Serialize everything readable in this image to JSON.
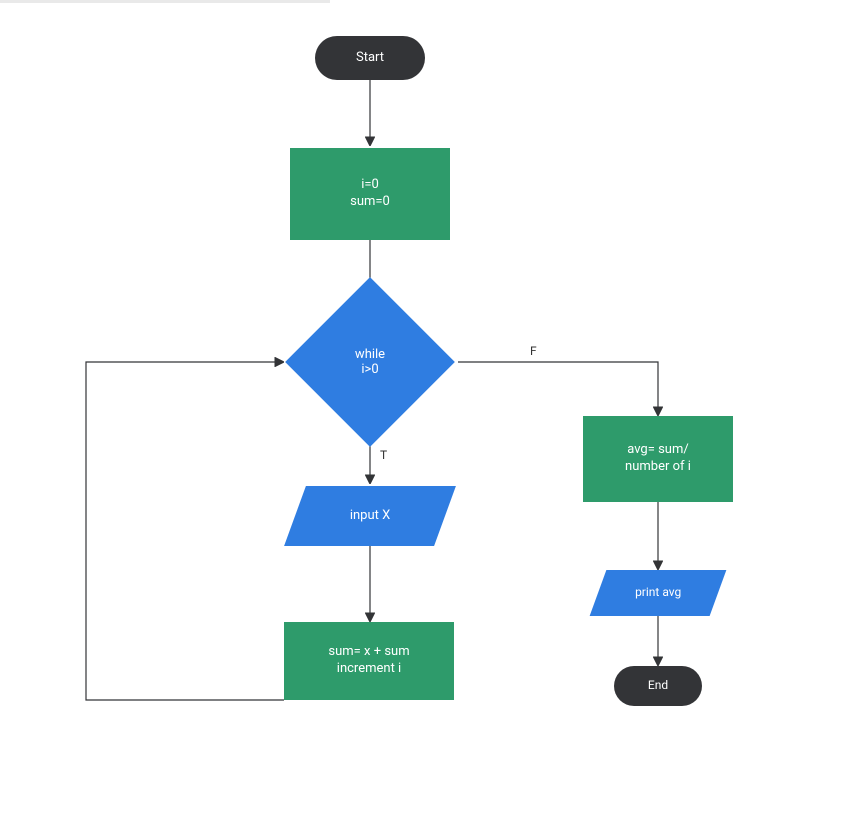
{
  "nodes": {
    "start": "Start",
    "init_line1": "i=0",
    "init_line2": "sum=0",
    "decision_line1": "while",
    "decision_line2": "i>0",
    "input": "input X",
    "sum_line1": "sum= x + sum",
    "sum_line2": "increment i",
    "avg_line1": "avg= sum/",
    "avg_line2": "number of i",
    "print": "print avg",
    "end": "End"
  },
  "edges": {
    "true_label": "T",
    "false_label": "F"
  },
  "colors": {
    "terminator": "#333437",
    "process": "#2e9b6b",
    "io_decision": "#2f7de1",
    "line": "#333437"
  }
}
